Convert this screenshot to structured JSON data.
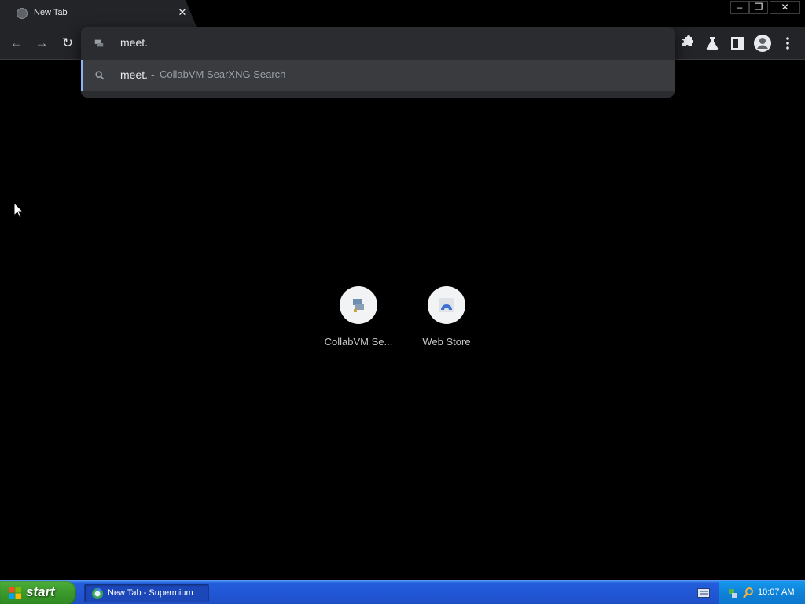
{
  "browser": {
    "tab": {
      "title": "New Tab",
      "close_glyph": "✕"
    },
    "window_controls": {
      "minimize": "–",
      "maximize": "❐",
      "close": "✕"
    },
    "nav": {
      "back_glyph": "←",
      "forward_glyph": "→",
      "reload_glyph": "↻"
    }
  },
  "omnibox": {
    "input_value": "meet.",
    "suggestion": {
      "query": "meet.",
      "separator": "-",
      "engine": "CollabVM SearXNG Search",
      "icon": "search-icon"
    }
  },
  "toolbar_icons": [
    "extensions-icon",
    "labs-icon",
    "side-panel-icon",
    "profile-icon",
    "menu-icon"
  ],
  "shortcuts": [
    {
      "label": "CollabVM Se...",
      "icon": "collabvm-icon"
    },
    {
      "label": "Web Store",
      "icon": "web-store-icon"
    }
  ],
  "taskbar": {
    "start_label": "start",
    "task_label": "New Tab - Supermium",
    "clock": "10:07 AM"
  },
  "colors": {
    "accent": "#8ab4f8",
    "toolbar_bg": "#232427",
    "page_bg": "#000000",
    "taskbar_blue": "#245edb",
    "start_green": "#3c9a2d"
  }
}
